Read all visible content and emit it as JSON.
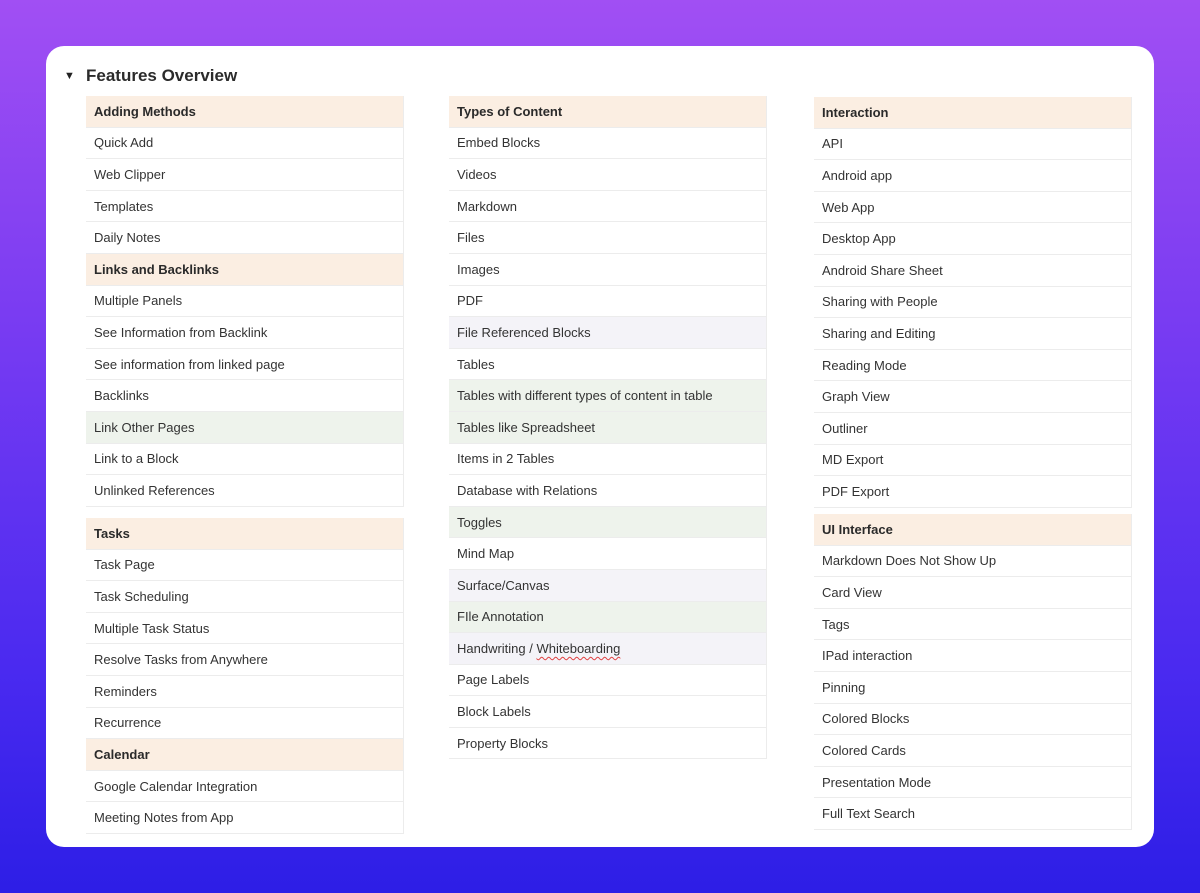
{
  "header": {
    "title": "Features Overview",
    "toggle_icon": "triangle-down-icon"
  },
  "colors": {
    "section_header": "#fbeee2",
    "green_highlight": "#eef3ec",
    "purple_highlight": "#f4f3f8"
  },
  "columns": [
    {
      "rows": [
        {
          "label": "Adding Methods",
          "style": "h"
        },
        {
          "label": "Quick Add",
          "style": "w"
        },
        {
          "label": "Web Clipper",
          "style": "w"
        },
        {
          "label": "Templates",
          "style": "w"
        },
        {
          "label": "Daily Notes",
          "style": "w"
        },
        {
          "label": "Links and Backlinks",
          "style": "h"
        },
        {
          "label": "Multiple Panels",
          "style": "w"
        },
        {
          "label": "See Information from Backlink",
          "style": "w"
        },
        {
          "label": "See information from linked page",
          "style": "w"
        },
        {
          "label": "Backlinks",
          "style": "w"
        },
        {
          "label": "Link Other Pages",
          "style": "g"
        },
        {
          "label": "Link to a Block",
          "style": "w"
        },
        {
          "label": "Unlinked References",
          "style": "w"
        }
      ]
    },
    {
      "rows": [
        {
          "label": "Tasks",
          "style": "h"
        },
        {
          "label": "Task Page",
          "style": "w"
        },
        {
          "label": "Task Scheduling",
          "style": "w"
        },
        {
          "label": "Multiple Task Status",
          "style": "w"
        },
        {
          "label": "Resolve Tasks from Anywhere",
          "style": "w"
        },
        {
          "label": "Reminders",
          "style": "w"
        },
        {
          "label": "Recurrence",
          "style": "w"
        },
        {
          "label": "Calendar",
          "style": "h"
        },
        {
          "label": "Google Calendar Integration",
          "style": "w"
        },
        {
          "label": "Meeting Notes from App",
          "style": "w"
        }
      ]
    },
    {
      "rows": [
        {
          "label": "Types of Content",
          "style": "h"
        },
        {
          "label": "Embed Blocks",
          "style": "w"
        },
        {
          "label": "Videos",
          "style": "w"
        },
        {
          "label": "Markdown",
          "style": "w"
        },
        {
          "label": "Files",
          "style": "w"
        },
        {
          "label": "Images",
          "style": "w"
        },
        {
          "label": "PDF",
          "style": "w"
        },
        {
          "label": "File Referenced Blocks",
          "style": "p"
        },
        {
          "label": "Tables",
          "style": "w"
        },
        {
          "label": "Tables with different types of content in table",
          "style": "g"
        },
        {
          "label": "Tables like Spreadsheet",
          "style": "g"
        },
        {
          "label": "Items in 2 Tables",
          "style": "w"
        },
        {
          "label": "Database with Relations",
          "style": "w"
        },
        {
          "label": "Toggles",
          "style": "g"
        },
        {
          "label": "Mind Map",
          "style": "w"
        },
        {
          "label": "Surface/Canvas",
          "style": "p"
        },
        {
          "label": "FIle Annotation",
          "style": "g"
        },
        {
          "label": "Handwriting / Whiteboarding",
          "style": "p"
        },
        {
          "label": "Page Labels",
          "style": "w"
        },
        {
          "label": "Block Labels",
          "style": "w"
        },
        {
          "label": "Property Blocks",
          "style": "w"
        }
      ]
    },
    {
      "rows": [
        {
          "label": "Interaction",
          "style": "h"
        },
        {
          "label": "API",
          "style": "w"
        },
        {
          "label": "Android app",
          "style": "w"
        },
        {
          "label": "Web App",
          "style": "w"
        },
        {
          "label": "Desktop App",
          "style": "w"
        },
        {
          "label": "Android Share Sheet",
          "style": "w"
        },
        {
          "label": "Sharing with People",
          "style": "w"
        },
        {
          "label": "Sharing and Editing",
          "style": "w"
        },
        {
          "label": "Reading Mode",
          "style": "w"
        },
        {
          "label": "Graph View",
          "style": "w"
        },
        {
          "label": "Outliner",
          "style": "w"
        },
        {
          "label": "MD Export",
          "style": "w"
        },
        {
          "label": "PDF Export",
          "style": "w"
        }
      ]
    },
    {
      "rows": [
        {
          "label": "UI Interface",
          "style": "h"
        },
        {
          "label": "Markdown Does Not Show Up",
          "style": "w"
        },
        {
          "label": "Card View",
          "style": "w"
        },
        {
          "label": "Tags",
          "style": "w"
        },
        {
          "label": "IPad interaction",
          "style": "w"
        },
        {
          "label": "Pinning",
          "style": "w"
        },
        {
          "label": "Colored Blocks",
          "style": "w"
        },
        {
          "label": "Colored Cards",
          "style": "w"
        },
        {
          "label": "Presentation Mode",
          "style": "w"
        },
        {
          "label": "Full Text Search",
          "style": "w"
        }
      ]
    }
  ]
}
